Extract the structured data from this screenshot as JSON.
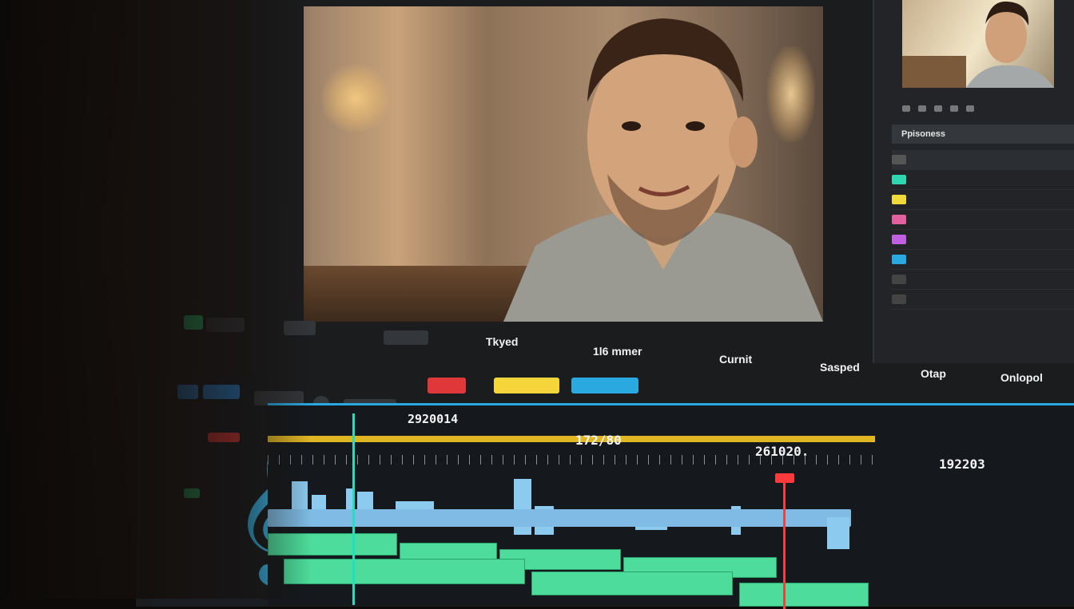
{
  "toolbar": {
    "label_1": "Tkyed",
    "label_2": "1l6 mmer",
    "label_3": "Curnit",
    "label_4": "Sasped",
    "label_5": "Otap",
    "label_6": "Onlopol"
  },
  "timeline": {
    "tc_start": "2920014",
    "tc_mid": "172/80",
    "tc_current": "261020.",
    "tc_end": "192203"
  },
  "panel": {
    "title": "Ppisoness"
  },
  "colors": {
    "accent_blue": "#2aa8e0",
    "ruler_yellow": "#e0b623",
    "playhead_red": "#ff3a3a",
    "track_green": "#4ddc9c",
    "track_blue": "#8ccaf0",
    "clef": "#36b5e8"
  },
  "icons": [
    "treble-clef-icon",
    "play-icon",
    "gear-icon"
  ]
}
